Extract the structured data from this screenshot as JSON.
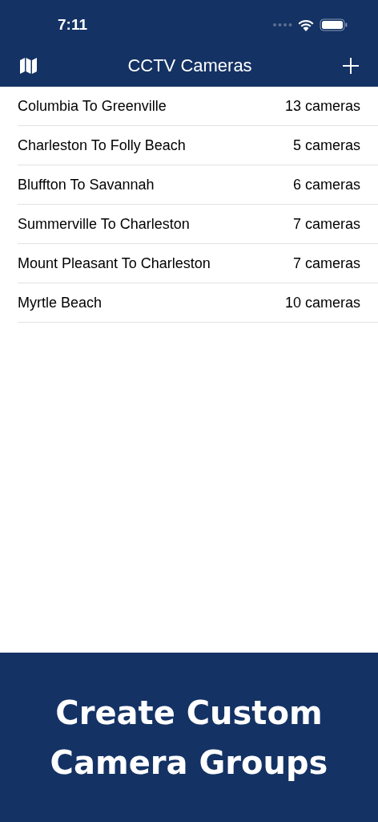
{
  "status_bar": {
    "time": "7:11"
  },
  "nav_bar": {
    "title": "CCTV Cameras"
  },
  "groups": [
    {
      "name": "Columbia To Greenville",
      "count": "13 cameras"
    },
    {
      "name": "Charleston To Folly Beach",
      "count": "5 cameras"
    },
    {
      "name": "Bluffton To Savannah",
      "count": "6 cameras"
    },
    {
      "name": "Summerville To Charleston",
      "count": "7 cameras"
    },
    {
      "name": "Mount Pleasant To Charleston",
      "count": "7 cameras"
    },
    {
      "name": "Myrtle Beach",
      "count": "10 cameras"
    }
  ],
  "banner": {
    "text": "Create Custom Camera Groups"
  }
}
